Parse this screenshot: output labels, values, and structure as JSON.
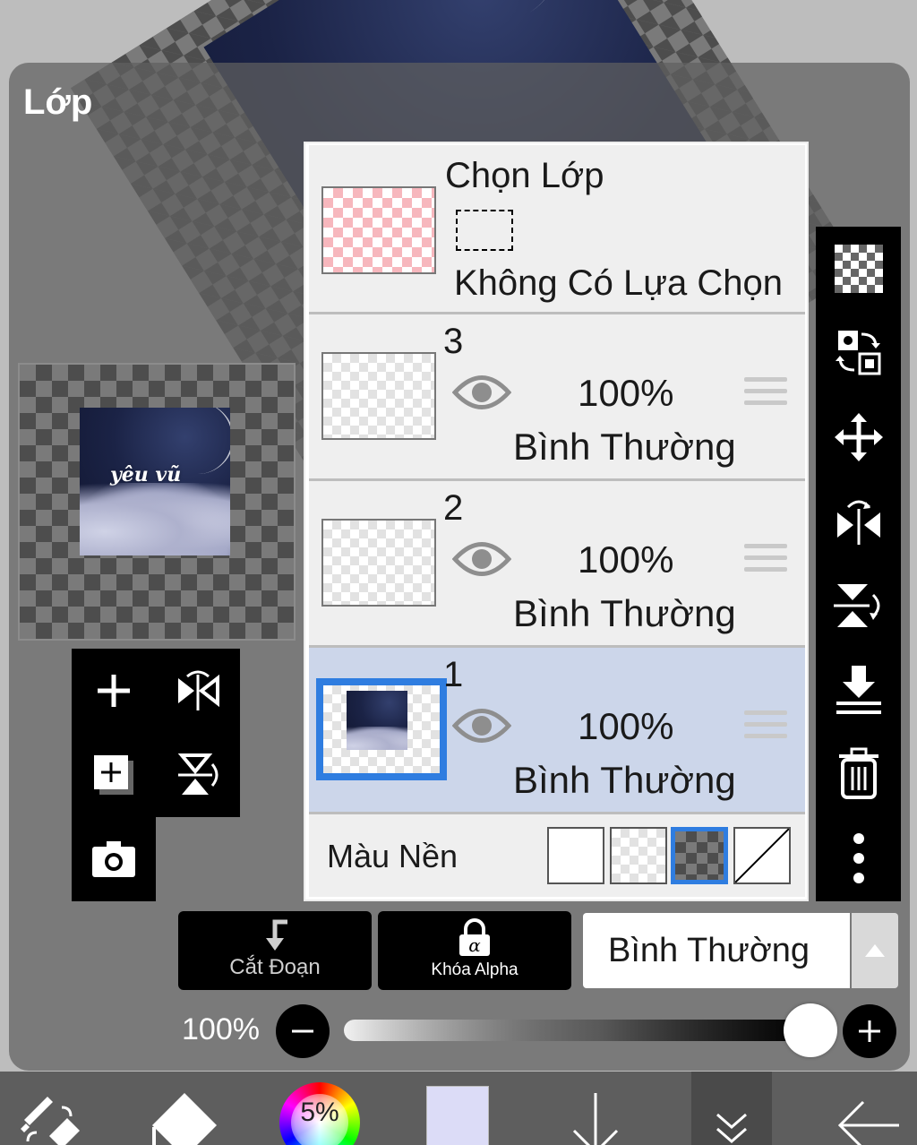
{
  "panel": {
    "title": "Lớp"
  },
  "selection_layer": {
    "title": "Chọn Lớp",
    "status": "Không Có Lựa Chọn"
  },
  "layers": [
    {
      "number": "3",
      "opacity": "100%",
      "blend": "Bình Thường",
      "visible": true,
      "selected": false
    },
    {
      "number": "2",
      "opacity": "100%",
      "blend": "Bình Thường",
      "visible": true,
      "selected": false
    },
    {
      "number": "1",
      "opacity": "100%",
      "blend": "Bình Thường",
      "visible": true,
      "selected": true
    }
  ],
  "background_color": {
    "label": "Màu Nền",
    "options": [
      "white",
      "checker-light",
      "checker-dark",
      "none"
    ],
    "selected": "checker-dark"
  },
  "actions": {
    "clip_label": "Cắt Đoạn",
    "alpha_lock_label": "Khóa Alpha",
    "blend_mode": "Bình Thường"
  },
  "opacity_slider": {
    "value_label": "100%",
    "value": 100
  },
  "preview": {
    "artwork_text": "yêu vũ"
  },
  "bottom_bar": {
    "brush_size_label": "5%",
    "current_color": "#dcdcf7"
  },
  "colors": {
    "selection_blue": "#2f7de0",
    "selected_row": "#ccd6ea"
  },
  "icons": {
    "left_tools": [
      "add-layer-icon",
      "flip-horizontal-icon",
      "duplicate-layer-icon",
      "flip-vertical-icon",
      "camera-icon"
    ],
    "right_tools": [
      "transparency-icon",
      "swap-icon",
      "move-icon",
      "flip-horizontal-icon",
      "flip-vertical-icon",
      "merge-down-icon",
      "trash-icon",
      "more-icon"
    ]
  }
}
